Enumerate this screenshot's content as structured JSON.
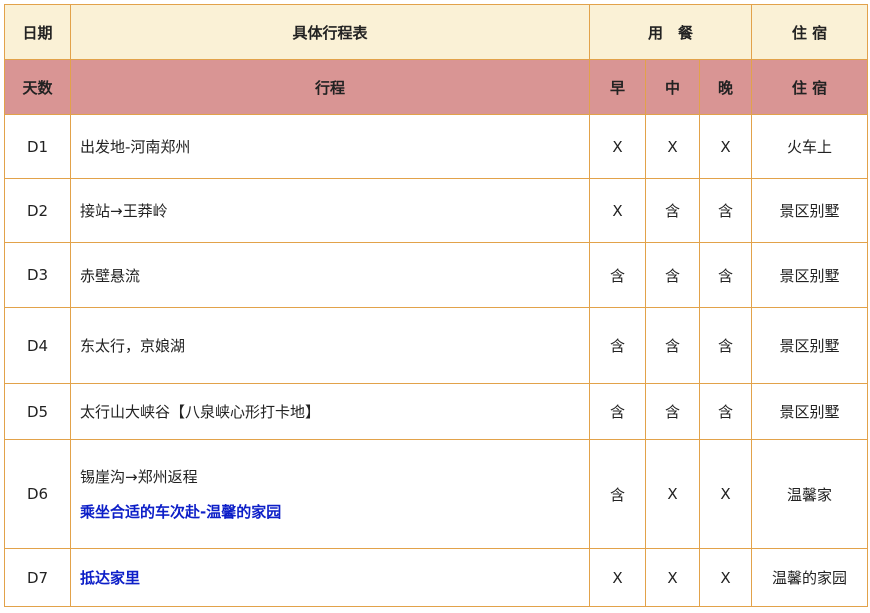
{
  "header": {
    "date": "日期",
    "itinerary_title": "具体行程表",
    "meals": "用　餐",
    "stay": "住 宿"
  },
  "subheader": {
    "days": "天数",
    "itinerary": "行程",
    "breakfast": "早",
    "lunch": "中",
    "dinner": "晚",
    "stay": "住 宿"
  },
  "rows": [
    {
      "day": "D1",
      "lines": [
        "出发地-河南郑州"
      ],
      "breakfast": "X",
      "lunch": "X",
      "dinner": "X",
      "stay": "火车上"
    },
    {
      "day": "D2",
      "lines": [
        "接站→王莽岭"
      ],
      "breakfast": "X",
      "lunch": "含",
      "dinner": "含",
      "stay": "景区别墅"
    },
    {
      "day": "D3",
      "lines": [
        "赤壁悬流"
      ],
      "breakfast": "含",
      "lunch": "含",
      "dinner": "含",
      "stay": "景区别墅"
    },
    {
      "day": "D4",
      "lines": [
        "东太行，京娘湖"
      ],
      "breakfast": "含",
      "lunch": "含",
      "dinner": "含",
      "stay": "景区别墅"
    },
    {
      "day": "D5",
      "lines": [
        "太行山大峡谷【八泉峡心形打卡地】"
      ],
      "breakfast": "含",
      "lunch": "含",
      "dinner": "含",
      "stay": "景区别墅"
    },
    {
      "day": "D6",
      "lines": [
        "锡崖沟→郑州返程",
        "乘坐合适的车次赴-温馨的家园"
      ],
      "breakfast": "含",
      "lunch": "X",
      "dinner": "X",
      "stay": "温馨家"
    },
    {
      "day": "D7",
      "lines": [
        "抵达家里"
      ],
      "breakfast": "X",
      "lunch": "X",
      "dinner": "X",
      "stay": "温馨的家园"
    }
  ],
  "colors": {
    "header_bg": "#faf1d6",
    "subheader_bg": "#d99594",
    "border": "#e2a24a",
    "highlight_text": "#0d1fc8"
  }
}
